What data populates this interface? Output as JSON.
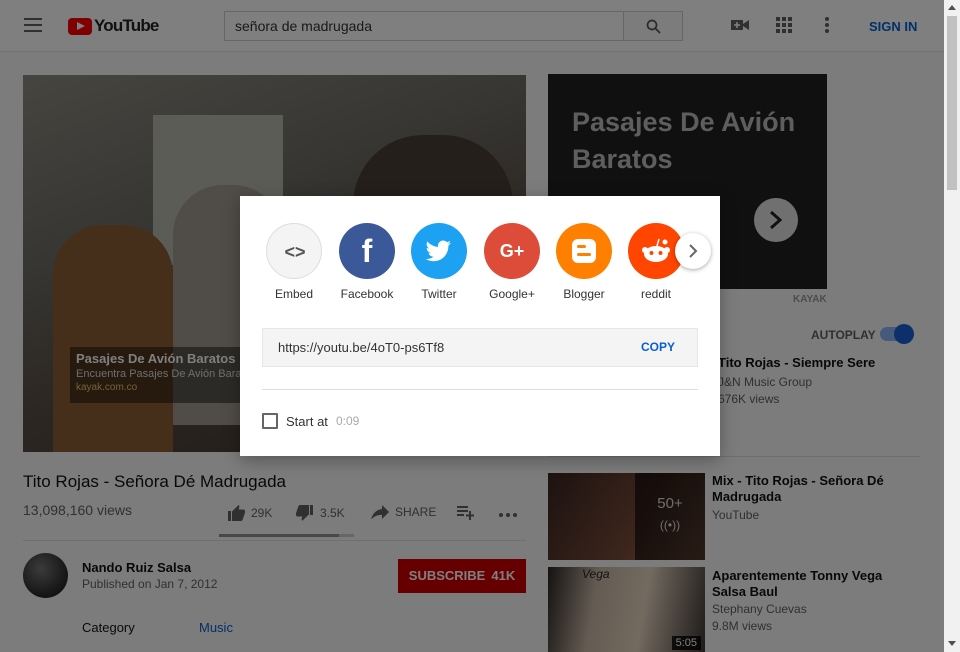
{
  "header": {
    "logo_text": "YouTube",
    "search_value": "señora de madrugada",
    "signin_label": "SIGN IN"
  },
  "player": {
    "ad_title": "Pasajes De Avión Baratos",
    "ad_subtitle": "Encuentra Pasajes De Avión Bara",
    "ad_url": "kayak.com.co"
  },
  "video": {
    "title": "Tito Rojas - Señora Dé Madrugada",
    "views": "13,098,160 views",
    "likes": "29K",
    "dislikes": "3.5K",
    "share_label": "SHARE",
    "like_ratio": 0.89
  },
  "channel": {
    "name": "Nando Ruiz Salsa",
    "published": "Published on Jan 7, 2012",
    "subscribe_label": "SUBSCRIBE",
    "subscriber_count": "41K"
  },
  "meta": {
    "category_label": "Category",
    "category_value": "Music"
  },
  "side_ad": {
    "headline": "Pasajes De Avión Baratos",
    "brand": "KAYAK"
  },
  "autoplay": {
    "label": "AUTOPLAY",
    "on": true
  },
  "recommendations": [
    {
      "title": "Tito Rojas - Siempre Sere",
      "channel": "J&N Music Group",
      "views": "676K views"
    },
    {
      "title": "Mix - Tito Rojas - Señora Dé Madrugada",
      "channel": "YouTube",
      "badge_count": "50+"
    },
    {
      "title": "Aparentemente Tonny Vega Salsa Baul",
      "channel": "Stephany Cuevas",
      "views": "9.8M views",
      "thumb_text": "Vega",
      "duration": "5:05"
    }
  ],
  "share_dialog": {
    "services": [
      {
        "name": "embed",
        "label": "Embed",
        "color": "#f4f4f4"
      },
      {
        "name": "facebook",
        "label": "Facebook",
        "color": "#3b5998"
      },
      {
        "name": "twitter",
        "label": "Twitter",
        "color": "#1da1f2"
      },
      {
        "name": "googleplus",
        "label": "Google+",
        "color": "#dd4b39"
      },
      {
        "name": "blogger",
        "label": "Blogger",
        "color": "#ff8000"
      },
      {
        "name": "reddit",
        "label": "reddit",
        "color": "#ff4500"
      }
    ],
    "url": "https://youtu.be/4oT0-ps6Tf8",
    "copy_label": "COPY",
    "start_at_label": "Start at",
    "start_time": "0:09"
  }
}
